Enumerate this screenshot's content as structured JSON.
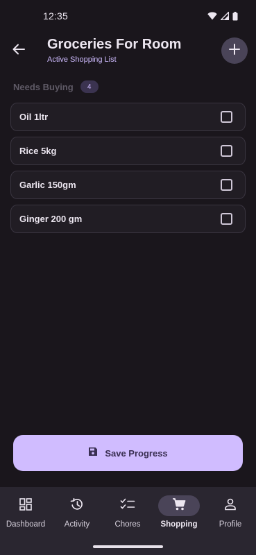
{
  "status_bar": {
    "time": "12:35"
  },
  "header": {
    "title": "Groceries For Room",
    "subtitle": "Active Shopping List"
  },
  "section": {
    "label": "Needs Buying",
    "count": "4"
  },
  "items": [
    {
      "label": "Oil 1ltr",
      "checked": false
    },
    {
      "label": "Rice 5kg",
      "checked": false
    },
    {
      "label": "Garlic 150gm",
      "checked": false
    },
    {
      "label": "Ginger 200 gm",
      "checked": false
    }
  ],
  "save_button": {
    "label": "Save Progress"
  },
  "nav": {
    "active": "Shopping",
    "items": [
      {
        "label": "Dashboard",
        "icon": "dashboard-icon"
      },
      {
        "label": "Activity",
        "icon": "history-icon"
      },
      {
        "label": "Chores",
        "icon": "checklist-icon"
      },
      {
        "label": "Shopping",
        "icon": "cart-icon"
      },
      {
        "label": "Profile",
        "icon": "person-icon"
      }
    ]
  },
  "colors": {
    "background": "#1a161c",
    "accent": "#d0bcff",
    "surface": "#211d24",
    "nav_background": "#2a2630"
  }
}
